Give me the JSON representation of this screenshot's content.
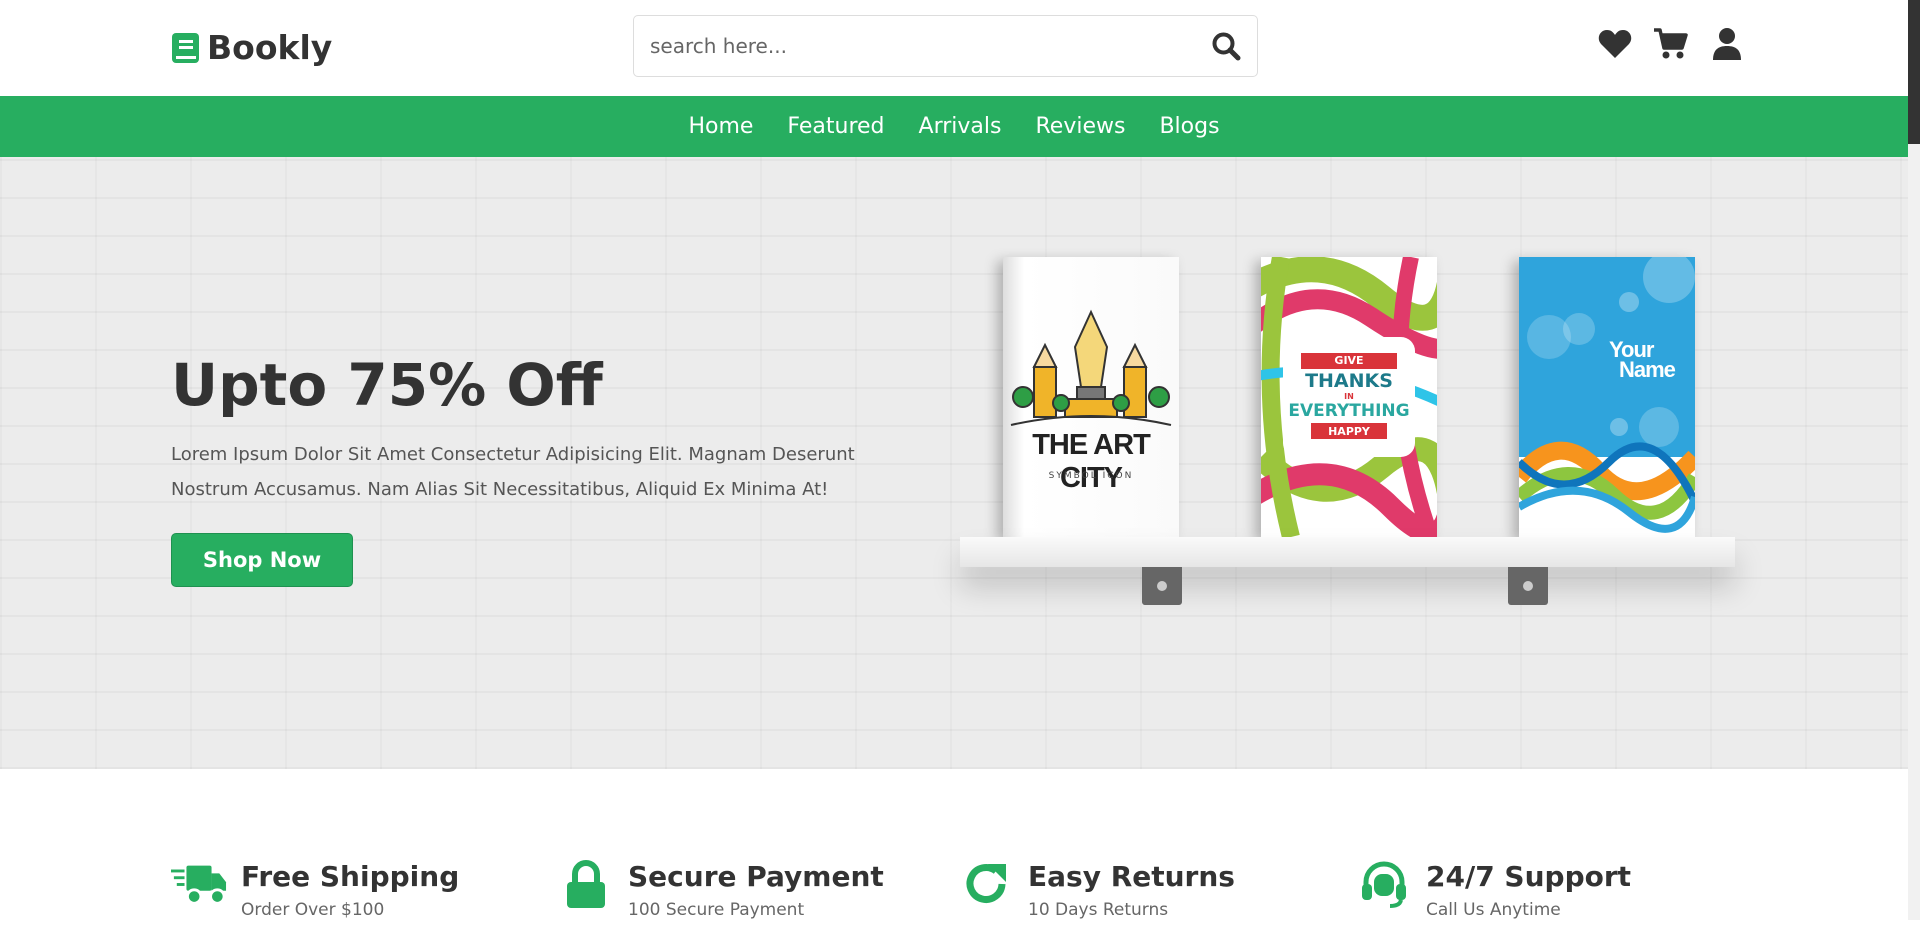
{
  "header": {
    "logo_text": "Bookly",
    "search_placeholder": "search here...",
    "icons": [
      "heart-icon",
      "cart-icon",
      "user-icon"
    ]
  },
  "nav": {
    "items": [
      "Home",
      "Featured",
      "Arrivals",
      "Reviews",
      "Blogs"
    ]
  },
  "hero": {
    "title": "Upto 75% Off",
    "text": "Lorem Ipsum Dolor Sit Amet Consectetur Adipisicing Elit. Magnam Deserunt Nostrum Accusamus. Nam Alias Sit Necessitatibus, Aliquid Ex Minima At!",
    "button": "Shop Now",
    "books": [
      {
        "title": "THE ART CITY",
        "subtitle": "SYMBOL ICON"
      },
      {
        "line1": "GIVE",
        "line2": "THANKS",
        "line3": "IN",
        "line4": "EVERYTHING",
        "line5": "HAPPY"
      },
      {
        "line1": "Your",
        "line2": "Name"
      }
    ]
  },
  "features": [
    {
      "icon": "truck-icon",
      "title": "Free Shipping",
      "text": "Order Over $100"
    },
    {
      "icon": "lock-icon",
      "title": "Secure Payment",
      "text": "100 Secure Payment"
    },
    {
      "icon": "redo-icon",
      "title": "Easy Returns",
      "text": "10 Days Returns"
    },
    {
      "icon": "headset-icon",
      "title": "24/7 Support",
      "text": "Call Us Anytime"
    }
  ],
  "colors": {
    "accent": "#27ae60",
    "text": "#333333",
    "hero_bg": "#ececec"
  }
}
